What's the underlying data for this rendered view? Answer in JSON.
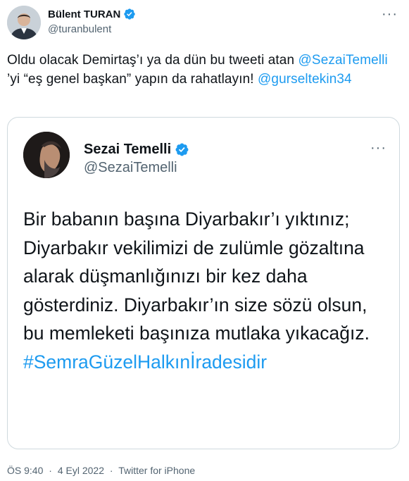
{
  "author": {
    "name": "Bülent TURAN",
    "handle": "@turanbulent"
  },
  "tweet": {
    "part1": "Oldu olacak Demirtaş’ı ya da dün bu tweeti atan ",
    "mention1": "@SezaiTemelli",
    "part2": " ’yi “eş genel başkan” yapın da rahatlayın! ",
    "mention2": "@gurseltekin34"
  },
  "quoted": {
    "name": "Sezai Temelli",
    "handle": "@SezaiTemelli",
    "text": "Bir babanın başına Diyarbakır’ı yıktınız; Diyarbakır vekilimizi de zulümle gözaltına alarak düşmanlığınızı bir kez daha gösterdiniz. Diyarbakır’ın size sözü olsun, bu memleketi başınıza mutlaka yıkacağız.",
    "hashtag": "#SemraGüzelHalkınİradesidir"
  },
  "meta": {
    "time": "ÖS 9:40",
    "sep1": "·",
    "date": "4 Eyl 2022",
    "sep2": "·",
    "source": "Twitter for iPhone"
  },
  "colors": {
    "accent": "#1d9bf0",
    "muted": "#536471",
    "verified": "#1d9bf0"
  },
  "icons": {
    "verified": "verified-badge-icon",
    "more": "more-options-icon"
  }
}
